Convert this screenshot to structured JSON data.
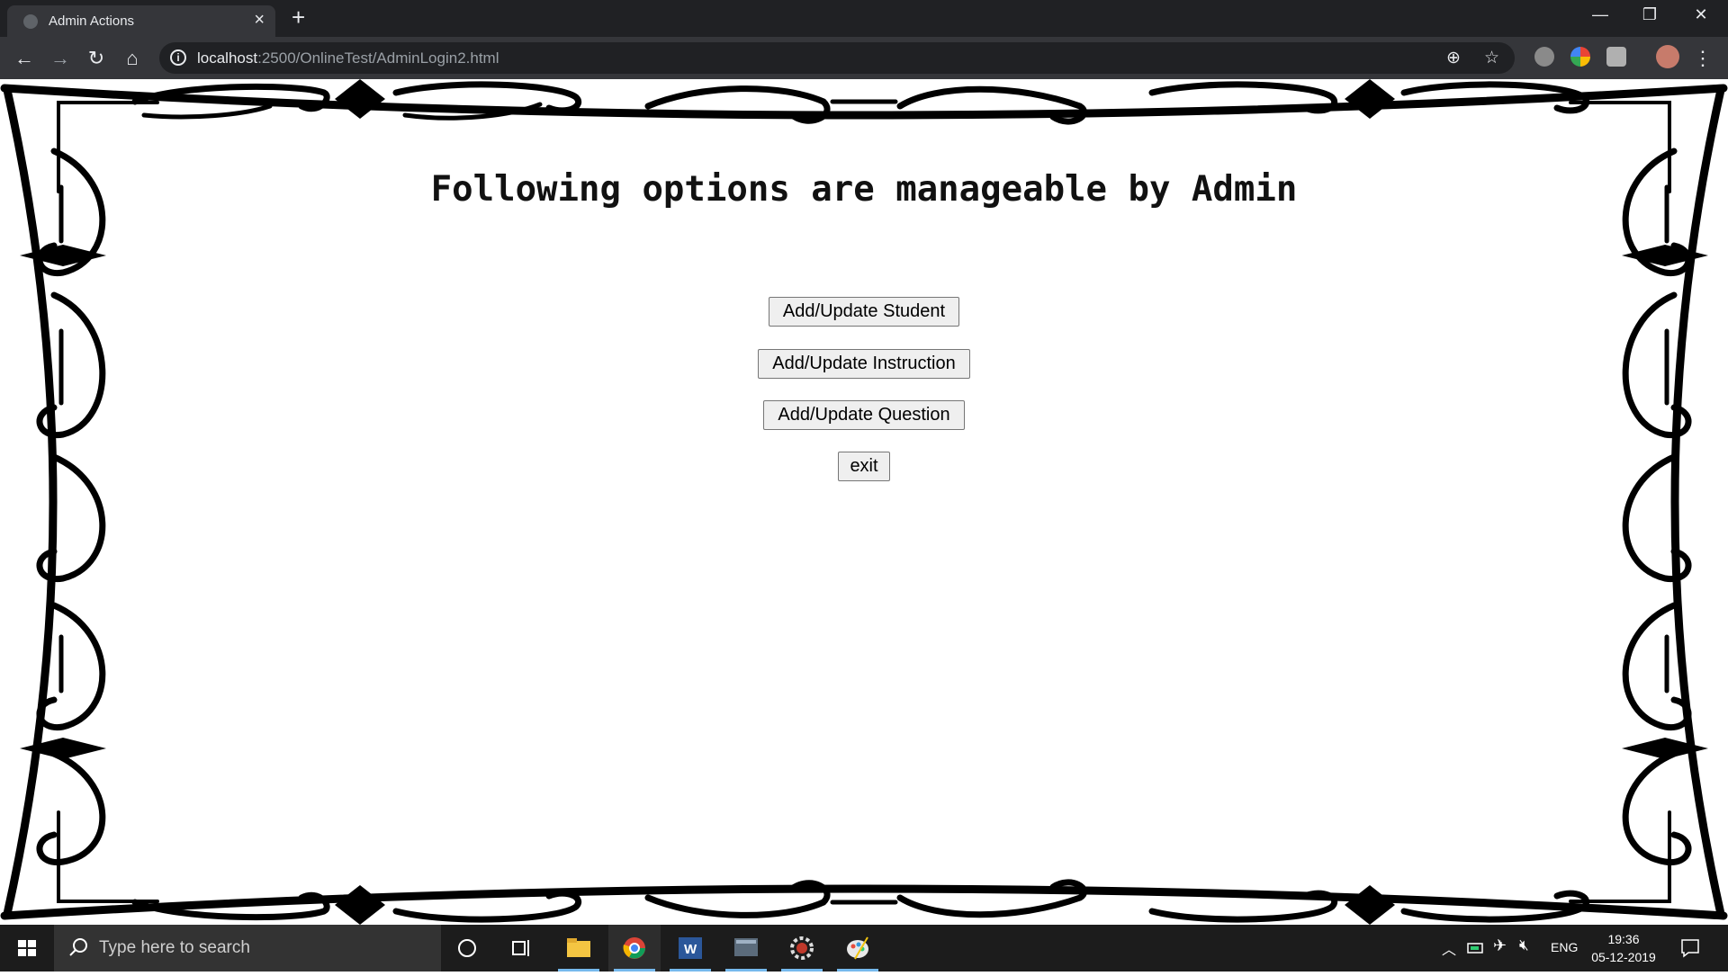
{
  "browser": {
    "tab_title": "Admin Actions",
    "url_host": "localhost",
    "url_rest": ":2500/OnlineTest/AdminLogin2.html"
  },
  "page": {
    "heading": "Following options are manageable by Admin",
    "buttons": {
      "student": "Add/Update Student",
      "instruction": "Add/Update Instruction",
      "question": "Add/Update Question",
      "exit": "exit"
    }
  },
  "taskbar": {
    "search_placeholder": "Type here to search",
    "language": "ENG",
    "time": "19:36",
    "date": "05-12-2019"
  },
  "colors": {
    "chrome_dark": "#202124",
    "chrome_toolbar": "#35363a",
    "taskbar": "#1c1c1c",
    "frame": "#000000"
  }
}
